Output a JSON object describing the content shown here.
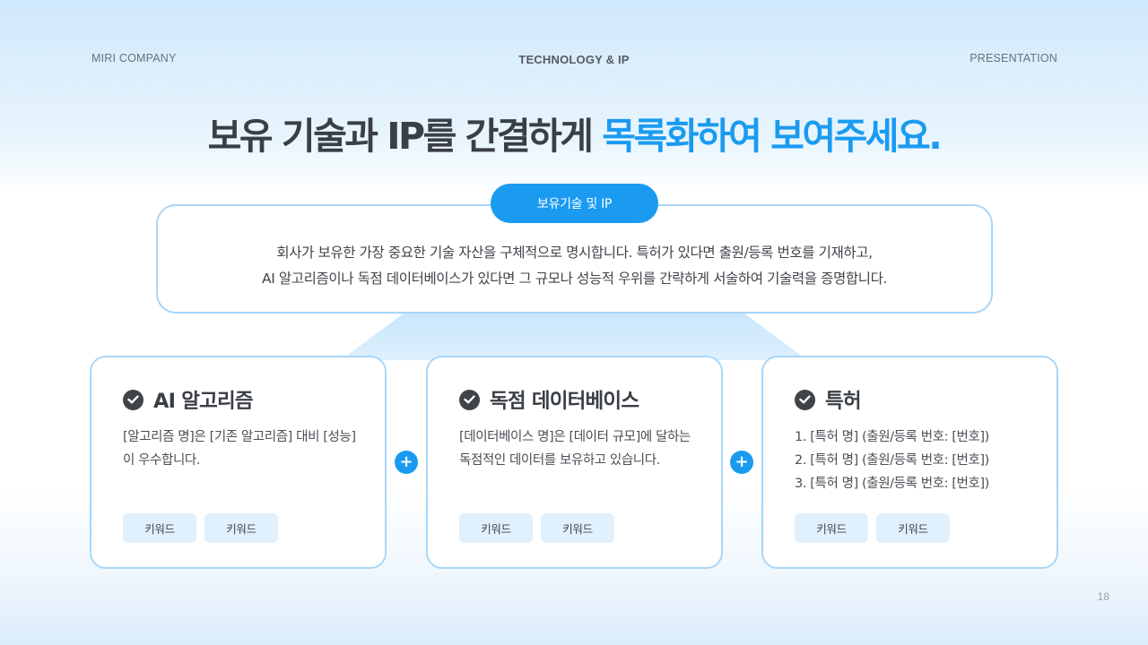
{
  "header": {
    "left": "MIRI COMPANY",
    "center": "TECHNOLOGY & IP",
    "right": "PRESENTATION"
  },
  "title": {
    "main": "보유 기술과 IP를 간결하게 ",
    "accent": "목록화하여 보여주세요."
  },
  "summary": {
    "pill": "보유기술 및 IP",
    "line1": "회사가 보유한 가장 중요한 기술 자산을 구체적으로 명시합니다. 특허가 있다면 출원/등록 번호를 기재하고,",
    "line2": "AI 알고리즘이나 독점 데이터베이스가 있다면 그 규모나 성능적 우위를 간략하게 서술하여 기술력을 증명합니다."
  },
  "cards": [
    {
      "title": "AI 알고리즘",
      "body": "[알고리즘 명]은 [기존 알고리즘] 대비 [성능]이 우수합니다.",
      "chips": [
        "키워드",
        "키워드"
      ]
    },
    {
      "title": "독점 데이터베이스",
      "body": "[데이터베이스 명]은 [데이터 규모]에 달하는 독점적인 데이터를 보유하고 있습니다.",
      "chips": [
        "키워드",
        "키워드"
      ]
    },
    {
      "title": "특허",
      "list": [
        "1. [특허 명] (출원/등록 번호: [번호])",
        "2. [특허 명] (출원/등록 번호: [번호])",
        "3. [특허 명] (출원/등록 번호: [번호])"
      ],
      "chips": [
        "키워드",
        "키워드"
      ]
    }
  ],
  "plus_symbol": "+",
  "page_number": "18",
  "colors": {
    "accent": "#1a9bf0",
    "border": "#a8d6f8",
    "chip_bg": "#e0f0fd",
    "text": "#3a3f45"
  },
  "icons": {
    "card_heading": "check-circle-icon",
    "connector": "plus-icon"
  }
}
